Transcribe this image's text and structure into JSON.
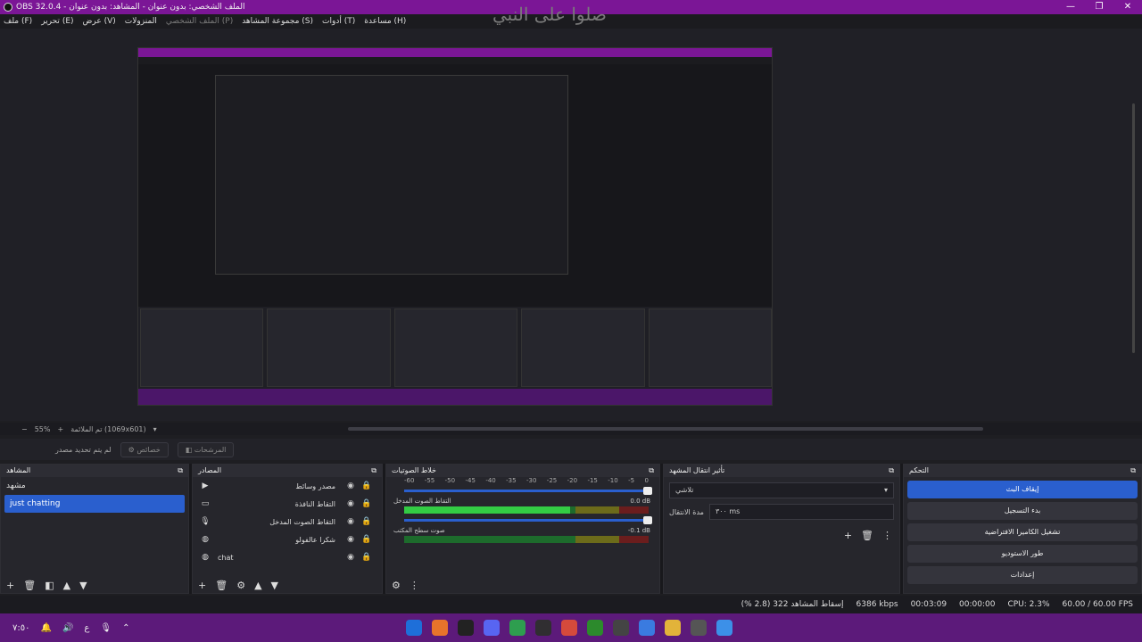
{
  "window": {
    "title": "OBS 32.0.4 - الملف الشخصي: بدون عنوان - المشاهد: بدون عنوان",
    "controls": [
      "—",
      "❐",
      "✕"
    ]
  },
  "overlay_text": "صلوا على النبي",
  "menu": [
    "ملف (F)",
    "تحرير (E)",
    "عرض (V)",
    "المنزولات",
    "الملف الشخصي (P)",
    "مجموعة المشاهد (S)",
    "أدوات (T)",
    "مساعدة (H)"
  ],
  "preview": {
    "zoom": "55%",
    "resolution": "تم الملائمة (1069x601)"
  },
  "context_bar": {
    "no_source": "لم يتم تحديد مصدر",
    "properties": "خصائص",
    "filters": "المرشحات"
  },
  "scenes": {
    "title": "المشاهد",
    "items": [
      "مشهد",
      "just chatting"
    ],
    "selected": "just chatting"
  },
  "sources": {
    "title": "المصادر",
    "items": [
      {
        "name": "مصدر وسائط",
        "icon": "play-icon"
      },
      {
        "name": "التقاط النافذة",
        "icon": "window-icon"
      },
      {
        "name": "التقاط الصوت المدخل",
        "icon": "mic-icon"
      },
      {
        "name": "شكرا عالفولو",
        "icon": "browser-icon"
      },
      {
        "name": "chat",
        "icon": "browser-icon"
      }
    ]
  },
  "mixer": {
    "title": "خلاط الصوتيات",
    "ticks": [
      "-60",
      "-55",
      "-50",
      "-45",
      "-40",
      "-35",
      "-30",
      "-25",
      "-20",
      "-15",
      "-10",
      "-5",
      "0"
    ],
    "channels": [
      {
        "name": "التقاط الصوت المدخل",
        "db": "0.0 dB",
        "level": 0.68
      },
      {
        "name": "صوت سطح المكتب",
        "db": "-0.1 dB",
        "level": 0.0
      }
    ]
  },
  "transitions": {
    "title": "تأثير انتقال المشهد",
    "type": "تلاشي",
    "duration_label": "مدة الانتقال",
    "duration_value": "٣٠٠ ms"
  },
  "controls": {
    "title": "التحكم",
    "buttons": [
      "إيقاف البث",
      "بدء التسجيل",
      "تشغيل الكاميرا الافتراضية",
      "طور الاستوديو",
      "إعدادات"
    ]
  },
  "status": {
    "dropped": "إسقاط المشاهد 322 (2.8 %)",
    "bitrate": "6386 kbps",
    "live_time": "00:03:09",
    "rec_time": "00:00:00",
    "cpu": "CPU: 2.3%",
    "fps": "60.00 / 60.00 FPS"
  },
  "taskbar": {
    "clock": "٧:٥٠",
    "lang": "ع",
    "icons": [
      {
        "name": "app-icon",
        "color": "#1e6fd9"
      },
      {
        "name": "firefox-icon",
        "color": "#e8742b"
      },
      {
        "name": "capcut-icon",
        "color": "#222222"
      },
      {
        "name": "discord-icon",
        "color": "#5865f2"
      },
      {
        "name": "chrome-icon",
        "color": "#2e9e4f"
      },
      {
        "name": "obs-icon",
        "color": "#302e31"
      },
      {
        "name": "store-icon",
        "color": "#d54a3c"
      },
      {
        "name": "xbox-icon",
        "color": "#2c8a2c"
      },
      {
        "name": "calendar-icon",
        "color": "#444444"
      },
      {
        "name": "copilot-icon",
        "color": "#3a7be0"
      },
      {
        "name": "folder-icon",
        "color": "#e2b33a"
      },
      {
        "name": "app2-icon",
        "color": "#555555"
      },
      {
        "name": "windows-icon",
        "color": "#3c90e8"
      }
    ]
  }
}
